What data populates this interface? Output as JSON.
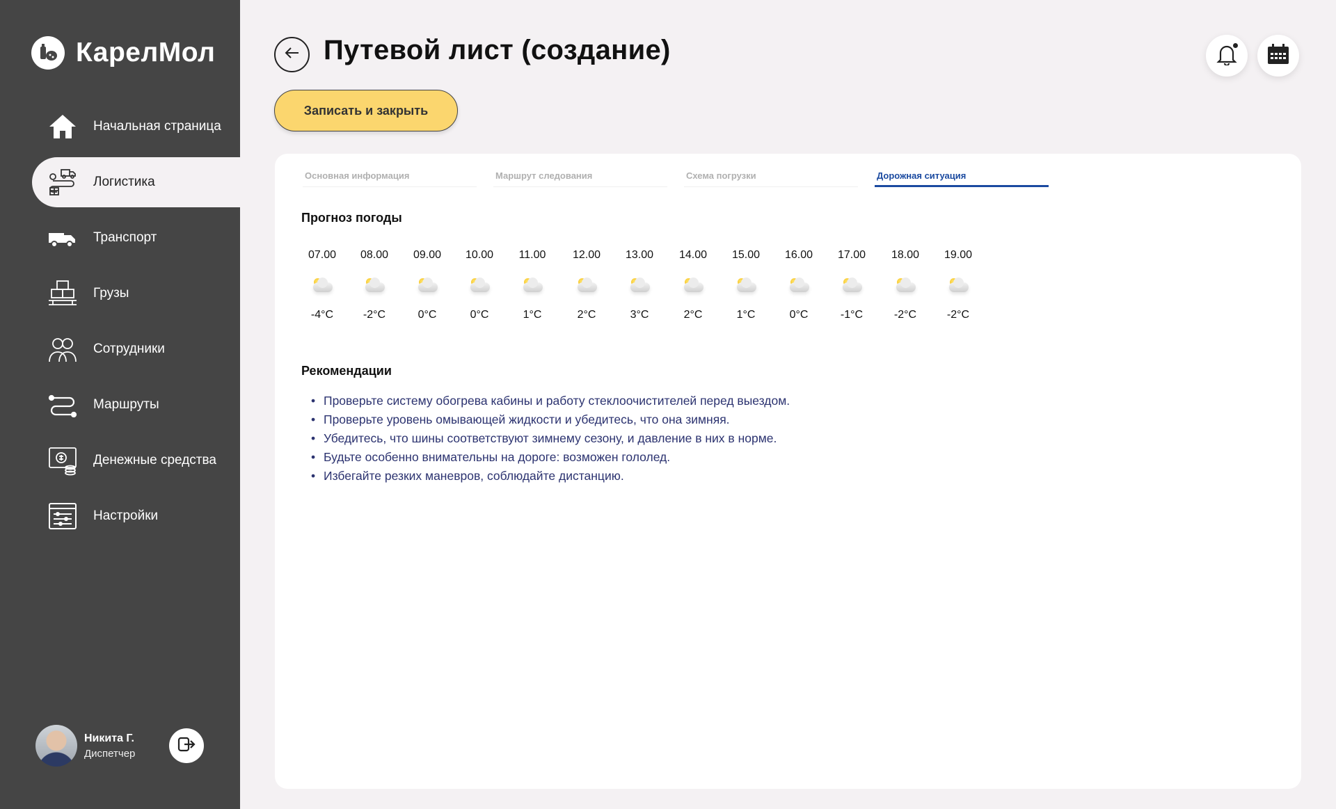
{
  "app": {
    "name": "КарелМол"
  },
  "sidebar": {
    "items": [
      {
        "label": "Начальная страница",
        "icon": "home-icon"
      },
      {
        "label": "Логистика",
        "icon": "logistics-icon",
        "active": true
      },
      {
        "label": "Транспорт",
        "icon": "truck-icon"
      },
      {
        "label": "Грузы",
        "icon": "cargo-icon"
      },
      {
        "label": "Сотрудники",
        "icon": "employees-icon"
      },
      {
        "label": "Маршруты",
        "icon": "routes-icon"
      },
      {
        "label": "Денежные средства",
        "icon": "money-icon"
      },
      {
        "label": "Настройки",
        "icon": "settings-icon"
      }
    ]
  },
  "user": {
    "name": "Никита Г.",
    "role": "Диспетчер"
  },
  "header": {
    "title": "Путевой лист (создание)",
    "save_label": "Записать и закрыть"
  },
  "tabs": [
    {
      "label": "Основная информация",
      "active": false
    },
    {
      "label": "Маршрут следования",
      "active": false
    },
    {
      "label": "Схема погрузки",
      "active": false
    },
    {
      "label": "Дорожная ситуация",
      "active": true
    }
  ],
  "weather": {
    "title": "Прогноз погоды",
    "hours": [
      {
        "time": "07.00",
        "temp": "-4°C",
        "icon": "partly-cloudy-icon"
      },
      {
        "time": "08.00",
        "temp": "-2°C",
        "icon": "partly-cloudy-icon"
      },
      {
        "time": "09.00",
        "temp": "0°C",
        "icon": "partly-cloudy-icon"
      },
      {
        "time": "10.00",
        "temp": "0°C",
        "icon": "partly-cloudy-icon"
      },
      {
        "time": "11.00",
        "temp": "1°C",
        "icon": "partly-cloudy-icon"
      },
      {
        "time": "12.00",
        "temp": "2°C",
        "icon": "partly-cloudy-icon"
      },
      {
        "time": "13.00",
        "temp": "3°C",
        "icon": "partly-cloudy-icon"
      },
      {
        "time": "14.00",
        "temp": "2°C",
        "icon": "partly-cloudy-icon"
      },
      {
        "time": "15.00",
        "temp": "1°C",
        "icon": "partly-cloudy-icon"
      },
      {
        "time": "16.00",
        "temp": "0°C",
        "icon": "partly-cloudy-icon"
      },
      {
        "time": "17.00",
        "temp": "-1°C",
        "icon": "partly-cloudy-icon"
      },
      {
        "time": "18.00",
        "temp": "-2°C",
        "icon": "partly-cloudy-icon"
      },
      {
        "time": "19.00",
        "temp": "-2°C",
        "icon": "partly-cloudy-icon"
      }
    ]
  },
  "recommendations": {
    "title": "Рекомендации",
    "items": [
      "Проверьте систему обогрева кабины и работу стеклоочистителей перед выездом.",
      "Проверьте уровень омывающей жидкости и убедитесь, что она зимняя.",
      "Убедитесь, что шины соответствуют зимнему сезону, и давление в них в норме.",
      "Будьте особенно внимательны на дороге: возможен гололед.",
      "Избегайте резких маневров, соблюдайте дистанцию."
    ]
  },
  "colors": {
    "sidebar_bg": "#454545",
    "page_bg": "#f4f1f3",
    "accent_button": "#fbd66e",
    "active_tab": "#1b4aa0",
    "recommendation_text": "#2c3370"
  }
}
